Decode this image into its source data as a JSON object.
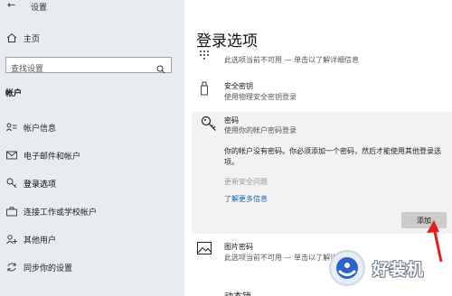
{
  "window": {
    "title": "设置"
  },
  "sidebar": {
    "home_label": "主页",
    "search_placeholder": "查找设置",
    "section": "帐户",
    "items": [
      {
        "label": "帐户信息",
        "icon": "account-info-icon"
      },
      {
        "label": "电子邮件和帐户",
        "icon": "email-icon"
      },
      {
        "label": "登录选项",
        "icon": "key-icon"
      },
      {
        "label": "连接工作或学校帐户",
        "icon": "briefcase-icon"
      },
      {
        "label": "其他用户",
        "icon": "other-users-icon"
      },
      {
        "label": "同步你的设置",
        "icon": "sync-icon"
      }
    ]
  },
  "main": {
    "title": "登录选项",
    "pin": {
      "subtitle": "此选项当前不可用 — 单击以了解详细信息"
    },
    "security_key": {
      "title": "安全密钥",
      "subtitle": "使用物理安全密钥登录"
    },
    "password": {
      "title": "密码",
      "subtitle": "使用你的帐户密码登录",
      "body": "你的帐户没有密码。你必须添加一个密码，然后才能使用其他登录选项。",
      "change_questions": "更新安全问题",
      "learn_more": "了解更多信息",
      "add_button": "添加"
    },
    "picture_password": {
      "title": "图片密码",
      "subtitle": "此选项当前不可用 — 单击以了解详细信息"
    },
    "dynamic_lock": {
      "title": "动态锁"
    }
  },
  "watermark": {
    "text": "好装机"
  },
  "colors": {
    "sidebar_bg": "#e6ecf0",
    "link": "#1a63b8",
    "add_button_bg": "#cccccc",
    "arrow": "#e02020",
    "panel_bg": "#f2f2f2"
  }
}
